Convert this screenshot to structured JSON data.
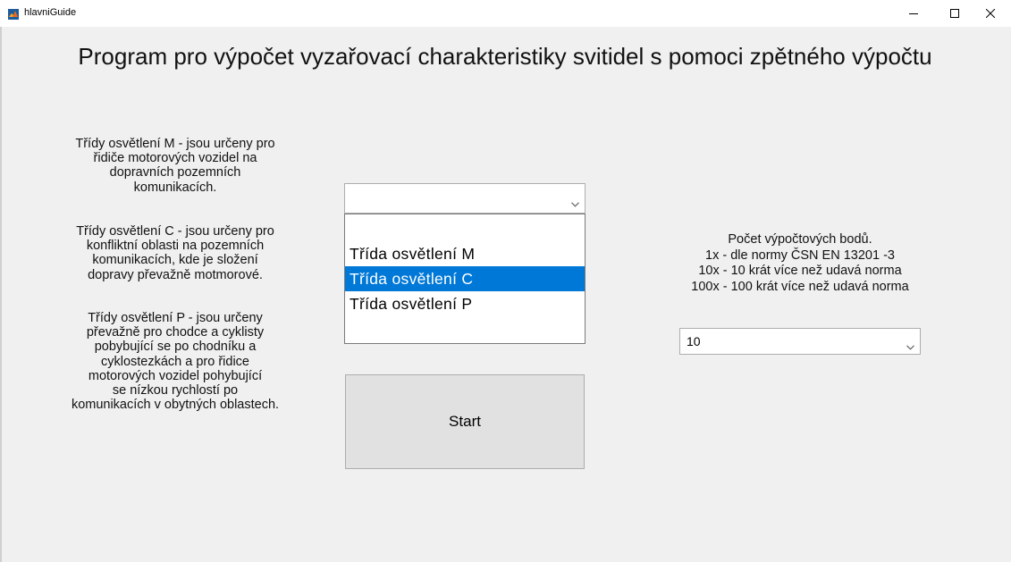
{
  "window": {
    "title": "hlavniGuide"
  },
  "heading": "Program pro výpočet vyzařovací charakteristiky svitidel s pomoci zpětného výpočtu",
  "descriptions": {
    "class_m": "Třídy osvětlení M - jsou určeny pro\nřidiče motorových vozidel na\ndopravních pozemních\nkomunikacích.",
    "class_c": "Třídy osvětlení C - jsou určeny pro\nkonfliktní oblasti na pozemních\nkomunikacích, kde je složení\ndopravy převažně motmorové.",
    "class_p": "Třídy osvětlení P - jsou určeny\npřevažně pro chodce a cyklisty\npobybující se po chodníku a\ncyklostezkách a pro řidice\nmotorových vozidel pohybující\nse nízkou rychlostí po\nkomunikacích v obytných oblastech."
  },
  "class_select": {
    "value": "",
    "options": [
      "Třída osvětlení M",
      "Třída osvětlení C",
      "Třída osvětlení P"
    ],
    "highlighted_index": 1
  },
  "start_button": {
    "label": "Start"
  },
  "points_info": "Počet výpočtových bodů.\n1x - dle normy  ČSN EN 13201 -3\n10x - 10 krát více než udavá norma\n100x - 100 krát více než udavá norma",
  "points_select": {
    "value": "10"
  },
  "colors": {
    "selection": "#0078d7",
    "background": "#f0f0f0"
  },
  "icons": {
    "app": "matlab-icon",
    "minimize": "minimize-icon",
    "maximize": "maximize-icon",
    "close": "close-icon",
    "dropdown": "chevron-down-icon"
  }
}
